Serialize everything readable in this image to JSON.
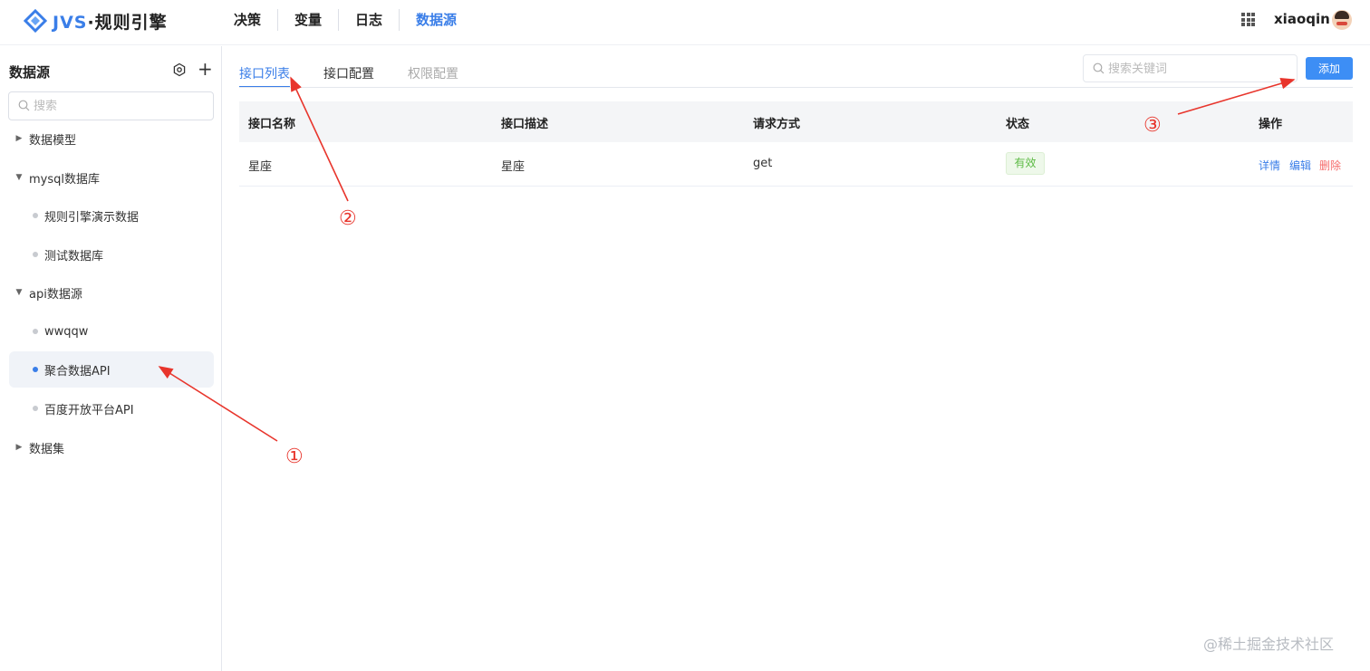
{
  "header": {
    "logo_brand": "JVS",
    "logo_text": "·规则引擎",
    "nav": [
      {
        "label": "决策"
      },
      {
        "label": "变量"
      },
      {
        "label": "日志"
      },
      {
        "label": "数据源",
        "active": true
      }
    ],
    "username": "xiaoqin"
  },
  "sidebar": {
    "title": "数据源",
    "search_placeholder": "搜索",
    "items": [
      {
        "label": "数据模型",
        "caret": "collapsed"
      },
      {
        "label": "mysql数据库",
        "caret": "expanded"
      },
      {
        "label": "规则引擎演示数据"
      },
      {
        "label": "测试数据库"
      },
      {
        "label": "api数据源",
        "caret": "expanded"
      },
      {
        "label": "wwqqw"
      },
      {
        "label": "聚合数据API",
        "active": true
      },
      {
        "label": "百度开放平台API"
      },
      {
        "label": "数据集",
        "caret": "collapsed"
      }
    ]
  },
  "main": {
    "tabs": [
      {
        "label": "接口列表",
        "state": "active"
      },
      {
        "label": "接口配置",
        "state": "normal"
      },
      {
        "label": "权限配置",
        "state": "disabled"
      }
    ],
    "search_placeholder": "搜索关键词",
    "add_label": "添加",
    "table": {
      "headers": [
        "接口名称",
        "接口描述",
        "请求方式",
        "状态",
        "操作"
      ],
      "rows": [
        {
          "name": "星座",
          "description": "星座",
          "method": "get",
          "status": "有效",
          "ops": [
            "详情",
            "编辑",
            "删除"
          ]
        }
      ]
    }
  },
  "annotations": {
    "markers": [
      "①",
      "②",
      "③"
    ],
    "color": "#e8352c"
  },
  "watermark": "@稀土掘金技术社区",
  "colors": {
    "accent": "#3a7ee8",
    "success": "#5cba44",
    "danger": "#f56c6c"
  }
}
